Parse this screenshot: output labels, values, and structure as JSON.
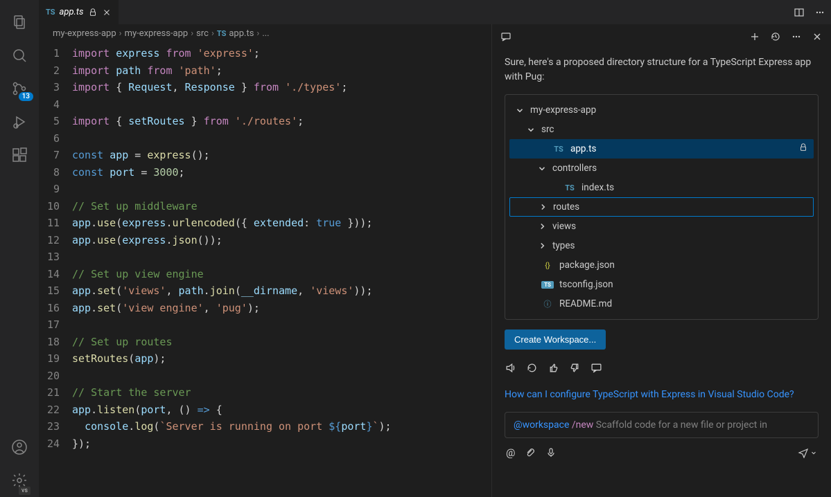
{
  "activity": {
    "sourceControlBadge": "13",
    "vsBadge": "vs"
  },
  "tab": {
    "iconLabel": "TS",
    "filename": "app.ts"
  },
  "breadcrumb": {
    "seg1": "my-express-app",
    "seg2": "my-express-app",
    "seg3": "src",
    "fileIcon": "TS",
    "file": "app.ts",
    "more": "..."
  },
  "code": {
    "lines": [
      {
        "n": "1",
        "tokens": [
          [
            "keyword",
            "import"
          ],
          [
            "plain",
            " "
          ],
          [
            "var",
            "express"
          ],
          [
            "plain",
            " "
          ],
          [
            "keyword",
            "from"
          ],
          [
            "plain",
            " "
          ],
          [
            "string",
            "'express'"
          ],
          [
            "punc",
            ";"
          ]
        ]
      },
      {
        "n": "2",
        "tokens": [
          [
            "keyword",
            "import"
          ],
          [
            "plain",
            " "
          ],
          [
            "var",
            "path"
          ],
          [
            "plain",
            " "
          ],
          [
            "keyword",
            "from"
          ],
          [
            "plain",
            " "
          ],
          [
            "string",
            "'path'"
          ],
          [
            "punc",
            ";"
          ]
        ]
      },
      {
        "n": "3",
        "tokens": [
          [
            "keyword",
            "import"
          ],
          [
            "plain",
            " { "
          ],
          [
            "var",
            "Request"
          ],
          [
            "plain",
            ", "
          ],
          [
            "var",
            "Response"
          ],
          [
            "plain",
            " } "
          ],
          [
            "keyword",
            "from"
          ],
          [
            "plain",
            " "
          ],
          [
            "string",
            "'./types'"
          ],
          [
            "punc",
            ";"
          ]
        ]
      },
      {
        "n": "4",
        "tokens": []
      },
      {
        "n": "5",
        "tokens": [
          [
            "keyword",
            "import"
          ],
          [
            "plain",
            " { "
          ],
          [
            "var",
            "setRoutes"
          ],
          [
            "plain",
            " } "
          ],
          [
            "keyword",
            "from"
          ],
          [
            "plain",
            " "
          ],
          [
            "string",
            "'./routes'"
          ],
          [
            "punc",
            ";"
          ]
        ]
      },
      {
        "n": "6",
        "tokens": []
      },
      {
        "n": "7",
        "tokens": [
          [
            "const",
            "const"
          ],
          [
            "plain",
            " "
          ],
          [
            "var",
            "app"
          ],
          [
            "plain",
            " = "
          ],
          [
            "func",
            "express"
          ],
          [
            "punc",
            "();"
          ]
        ]
      },
      {
        "n": "8",
        "tokens": [
          [
            "const",
            "const"
          ],
          [
            "plain",
            " "
          ],
          [
            "var",
            "port"
          ],
          [
            "plain",
            " = "
          ],
          [
            "num",
            "3000"
          ],
          [
            "punc",
            ";"
          ]
        ]
      },
      {
        "n": "9",
        "tokens": []
      },
      {
        "n": "10",
        "tokens": [
          [
            "comment",
            "// Set up middleware"
          ]
        ]
      },
      {
        "n": "11",
        "tokens": [
          [
            "var",
            "app"
          ],
          [
            "punc",
            "."
          ],
          [
            "func",
            "use"
          ],
          [
            "punc",
            "("
          ],
          [
            "var",
            "express"
          ],
          [
            "punc",
            "."
          ],
          [
            "func",
            "urlencoded"
          ],
          [
            "punc",
            "({ "
          ],
          [
            "var",
            "extended"
          ],
          [
            "punc",
            ": "
          ],
          [
            "const",
            "true"
          ],
          [
            "punc",
            " }));"
          ]
        ]
      },
      {
        "n": "12",
        "tokens": [
          [
            "var",
            "app"
          ],
          [
            "punc",
            "."
          ],
          [
            "func",
            "use"
          ],
          [
            "punc",
            "("
          ],
          [
            "var",
            "express"
          ],
          [
            "punc",
            "."
          ],
          [
            "func",
            "json"
          ],
          [
            "punc",
            "());"
          ]
        ]
      },
      {
        "n": "13",
        "tokens": []
      },
      {
        "n": "14",
        "tokens": [
          [
            "comment",
            "// Set up view engine"
          ]
        ]
      },
      {
        "n": "15",
        "tokens": [
          [
            "var",
            "app"
          ],
          [
            "punc",
            "."
          ],
          [
            "func",
            "set"
          ],
          [
            "punc",
            "("
          ],
          [
            "string",
            "'views'"
          ],
          [
            "punc",
            ", "
          ],
          [
            "var",
            "path"
          ],
          [
            "punc",
            "."
          ],
          [
            "func",
            "join"
          ],
          [
            "punc",
            "("
          ],
          [
            "var",
            "__dirname"
          ],
          [
            "punc",
            ", "
          ],
          [
            "string",
            "'views'"
          ],
          [
            "punc",
            "));"
          ]
        ]
      },
      {
        "n": "16",
        "tokens": [
          [
            "var",
            "app"
          ],
          [
            "punc",
            "."
          ],
          [
            "func",
            "set"
          ],
          [
            "punc",
            "("
          ],
          [
            "string",
            "'view engine'"
          ],
          [
            "punc",
            ", "
          ],
          [
            "string",
            "'pug'"
          ],
          [
            "punc",
            ");"
          ]
        ]
      },
      {
        "n": "17",
        "tokens": []
      },
      {
        "n": "18",
        "tokens": [
          [
            "comment",
            "// Set up routes"
          ]
        ]
      },
      {
        "n": "19",
        "tokens": [
          [
            "func",
            "setRoutes"
          ],
          [
            "punc",
            "("
          ],
          [
            "var",
            "app"
          ],
          [
            "punc",
            ");"
          ]
        ]
      },
      {
        "n": "20",
        "tokens": []
      },
      {
        "n": "21",
        "tokens": [
          [
            "comment",
            "// Start the server"
          ]
        ]
      },
      {
        "n": "22",
        "tokens": [
          [
            "var",
            "app"
          ],
          [
            "punc",
            "."
          ],
          [
            "func",
            "listen"
          ],
          [
            "punc",
            "("
          ],
          [
            "var",
            "port"
          ],
          [
            "punc",
            ", () "
          ],
          [
            "const",
            "=>"
          ],
          [
            "punc",
            " {"
          ]
        ]
      },
      {
        "n": "23",
        "tokens": [
          [
            "plain",
            "  "
          ],
          [
            "var",
            "console"
          ],
          [
            "punc",
            "."
          ],
          [
            "func",
            "log"
          ],
          [
            "punc",
            "("
          ],
          [
            "string",
            "`Server is running on port "
          ],
          [
            "const",
            "${"
          ],
          [
            "var",
            "port"
          ],
          [
            "const",
            "}"
          ],
          [
            "string",
            "`"
          ],
          [
            "punc",
            ");"
          ]
        ]
      },
      {
        "n": "24",
        "tokens": [
          [
            "punc",
            "});"
          ]
        ]
      }
    ]
  },
  "chat": {
    "responseText": "Sure, here's a proposed directory structure for a TypeScript Express app with Pug:",
    "tree": [
      {
        "indent": 0,
        "chevron": "down",
        "icon": "",
        "label": "my-express-app",
        "active": false,
        "focus": false,
        "lock": false
      },
      {
        "indent": 1,
        "chevron": "down",
        "icon": "",
        "label": "src",
        "active": false,
        "focus": false,
        "lock": false
      },
      {
        "indent": 2,
        "chevron": "",
        "icon": "TS",
        "iconClass": "icon-ts",
        "label": "app.ts",
        "active": true,
        "focus": false,
        "lock": true
      },
      {
        "indent": 2,
        "chevron": "down",
        "icon": "",
        "label": "controllers",
        "active": false,
        "focus": false,
        "lock": false
      },
      {
        "indent": 3,
        "chevron": "",
        "icon": "TS",
        "iconClass": "icon-ts",
        "label": "index.ts",
        "active": false,
        "focus": false,
        "lock": false
      },
      {
        "indent": 2,
        "chevron": "right",
        "icon": "",
        "label": "routes",
        "active": false,
        "focus": true,
        "lock": false
      },
      {
        "indent": 2,
        "chevron": "right",
        "icon": "",
        "label": "views",
        "active": false,
        "focus": false,
        "lock": false
      },
      {
        "indent": 2,
        "chevron": "right",
        "icon": "",
        "label": "types",
        "active": false,
        "focus": false,
        "lock": false
      },
      {
        "indent": 1,
        "chevron": "",
        "icon": "{}",
        "iconClass": "icon-json",
        "label": "package.json",
        "active": false,
        "focus": false,
        "lock": false
      },
      {
        "indent": 1,
        "chevron": "",
        "icon": "TS",
        "iconClass": "icon-ts",
        "iconBg": true,
        "label": "tsconfig.json",
        "active": false,
        "focus": false,
        "lock": false
      },
      {
        "indent": 1,
        "chevron": "",
        "icon": "ⓘ",
        "iconClass": "icon-readme",
        "label": "README.md",
        "active": false,
        "focus": false,
        "lock": false
      }
    ],
    "createButton": "Create Workspace...",
    "suggestedQuestion": "How can I configure TypeScript with Express in Visual Studio Code?",
    "inputMention": "@workspace",
    "inputSlash": "/new",
    "inputRest": " Scaffold code for a new file or project in"
  }
}
